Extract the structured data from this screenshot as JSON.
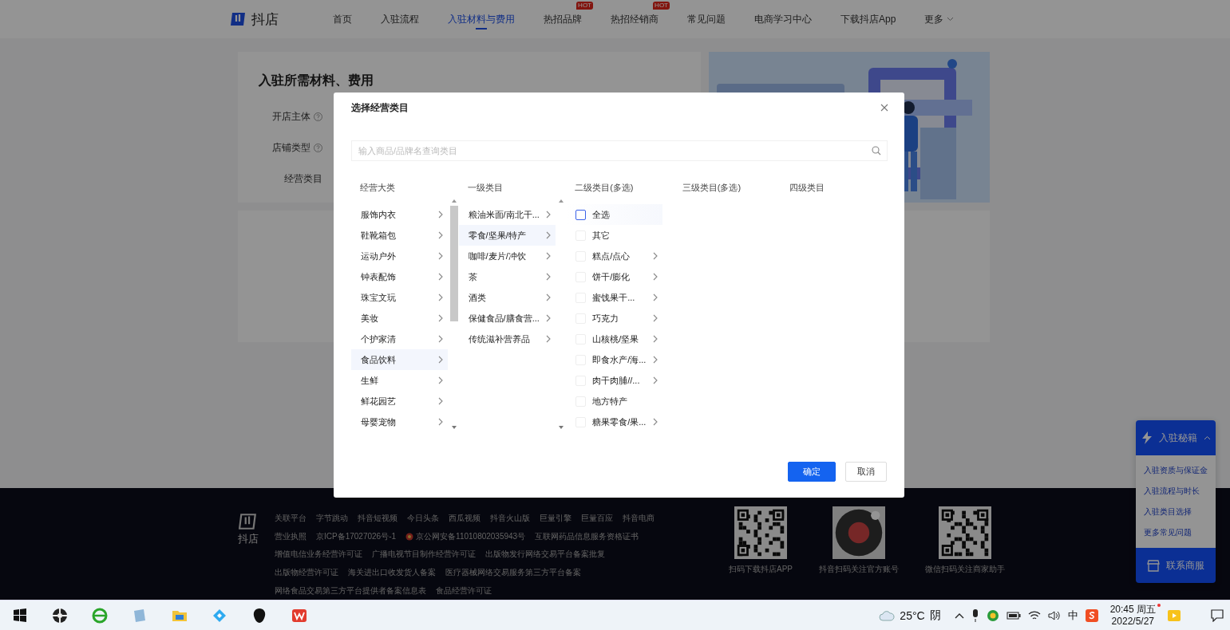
{
  "nav": {
    "logo": "抖店",
    "items": [
      {
        "label": "首页",
        "selected": false
      },
      {
        "label": "入驻流程",
        "selected": false
      },
      {
        "label": "入驻材料与费用",
        "selected": true
      },
      {
        "label": "热招品牌",
        "selected": false,
        "badge": "HOT"
      },
      {
        "label": "热招经销商",
        "selected": false,
        "badge": "HOT"
      },
      {
        "label": "常见问题",
        "selected": false
      },
      {
        "label": "电商学习中心",
        "selected": false
      },
      {
        "label": "下载抖店App",
        "selected": false
      },
      {
        "label": "更多",
        "selected": false,
        "kind": "dropdown"
      }
    ]
  },
  "page": {
    "title": "入驻所需材料、费用",
    "fields": [
      {
        "label": "开店主体",
        "help": true
      },
      {
        "label": "店铺类型",
        "help": true
      },
      {
        "label": "经营类目",
        "help": false
      }
    ]
  },
  "modal": {
    "title": "选择经营类目",
    "search": {
      "placeholder": "输入商品/品牌名查询类目"
    },
    "columns": [
      {
        "header": "经营大类",
        "kind": "list",
        "items": [
          {
            "label": "服饰内衣",
            "selected": false,
            "has_children": true
          },
          {
            "label": "鞋靴箱包",
            "selected": false,
            "has_children": true
          },
          {
            "label": "运动户外",
            "selected": false,
            "has_children": true
          },
          {
            "label": "钟表配饰",
            "selected": false,
            "has_children": true
          },
          {
            "label": "珠宝文玩",
            "selected": false,
            "has_children": true
          },
          {
            "label": "美妆",
            "selected": false,
            "has_children": true
          },
          {
            "label": "个护家清",
            "selected": false,
            "has_children": true
          },
          {
            "label": "食品饮料",
            "selected": true,
            "has_children": true
          },
          {
            "label": "生鲜",
            "selected": false,
            "has_children": true
          },
          {
            "label": "鲜花园艺",
            "selected": false,
            "has_children": true
          },
          {
            "label": "母婴宠物",
            "selected": false,
            "has_children": true
          }
        ]
      },
      {
        "header": "一级类目",
        "kind": "list",
        "items": [
          {
            "label": "粮油米面/南北干...",
            "selected": false,
            "has_children": true
          },
          {
            "label": "零食/坚果/特产",
            "selected": true,
            "has_children": true
          },
          {
            "label": "咖啡/麦片/冲饮",
            "selected": false,
            "has_children": true
          },
          {
            "label": "茶",
            "selected": false,
            "has_children": true
          },
          {
            "label": "酒类",
            "selected": false,
            "has_children": true
          },
          {
            "label": "保健食品/膳食营...",
            "selected": false,
            "has_children": true
          },
          {
            "label": "传统滋补营养品",
            "selected": false,
            "has_children": true
          }
        ]
      },
      {
        "header": "二级类目(多选)",
        "kind": "checklist",
        "items": [
          {
            "label": "全选",
            "checked": false,
            "has_children": false,
            "kind": "all"
          },
          {
            "label": "其它",
            "checked": false,
            "has_children": false
          },
          {
            "label": "糕点/点心",
            "checked": false,
            "has_children": true
          },
          {
            "label": "饼干/膨化",
            "checked": false,
            "has_children": true
          },
          {
            "label": "蜜饯果干...",
            "checked": false,
            "has_children": true
          },
          {
            "label": "巧克力",
            "checked": false,
            "has_children": true
          },
          {
            "label": "山核桃/坚果",
            "checked": false,
            "has_children": true
          },
          {
            "label": "即食水产/海...",
            "checked": false,
            "has_children": true
          },
          {
            "label": "肉干肉脯//...",
            "checked": false,
            "has_children": true
          },
          {
            "label": "地方特产",
            "checked": false,
            "has_children": false
          },
          {
            "label": "糖果零食/果...",
            "checked": false,
            "has_children": true
          }
        ]
      },
      {
        "header": "三级类目(多选)",
        "kind": "list"
      },
      {
        "header": "四级类目",
        "kind": "list"
      }
    ],
    "buttons": [
      {
        "label": "确定",
        "kind": "primary"
      },
      {
        "label": "取消",
        "kind": "default"
      }
    ]
  },
  "footer": {
    "logo": "抖店",
    "link_rows": [
      [
        {
          "text": "关联平台"
        },
        {
          "text": "字节跳动"
        },
        {
          "text": "抖音短视频"
        },
        {
          "text": "今日头条"
        },
        {
          "text": "西瓜视频"
        },
        {
          "text": "抖音火山版"
        },
        {
          "text": "巨量引擎"
        },
        {
          "text": "巨量百应"
        },
        {
          "text": "抖音电商"
        }
      ],
      [
        {
          "text": "营业执照"
        },
        {
          "text": "京ICP备17027026号-1"
        },
        {
          "text": "京公网安备11010802035943号",
          "kind": "badge"
        },
        {
          "text": "互联网药品信息服务资格证书"
        }
      ],
      [
        {
          "text": "增值电信业务经营许可证"
        },
        {
          "text": "广播电视节目制作经营许可证"
        },
        {
          "text": "出版物发行网络交易平台备案批复"
        }
      ],
      [
        {
          "text": "出版物经营许可证"
        },
        {
          "text": "海关进出口收发货人备案"
        },
        {
          "text": "医疗器械网络交易服务第三方平台备案"
        }
      ],
      [
        {
          "text": "网络食品交易第三方平台提供者备案信息表"
        },
        {
          "text": "食品经营许可证"
        }
      ]
    ],
    "codes": [
      {
        "caption": "扫码下载抖店APP",
        "kind": "square"
      },
      {
        "caption": "抖音扫码关注官方账号",
        "kind": "round"
      },
      {
        "caption": "微信扫码关注商家助手",
        "kind": "square"
      }
    ]
  },
  "widget": {
    "title": "入驻秘籍",
    "expanded": true,
    "links": [
      "入驻资质与保证金",
      "入驻流程与时长",
      "入驻类目选择",
      "更多常见问题"
    ],
    "contact": "联系商服"
  },
  "taskbar": {
    "weather": "25°C",
    "condition": "阴",
    "ime": "中",
    "time": "20:45 周五",
    "date": "2022/5/27"
  }
}
